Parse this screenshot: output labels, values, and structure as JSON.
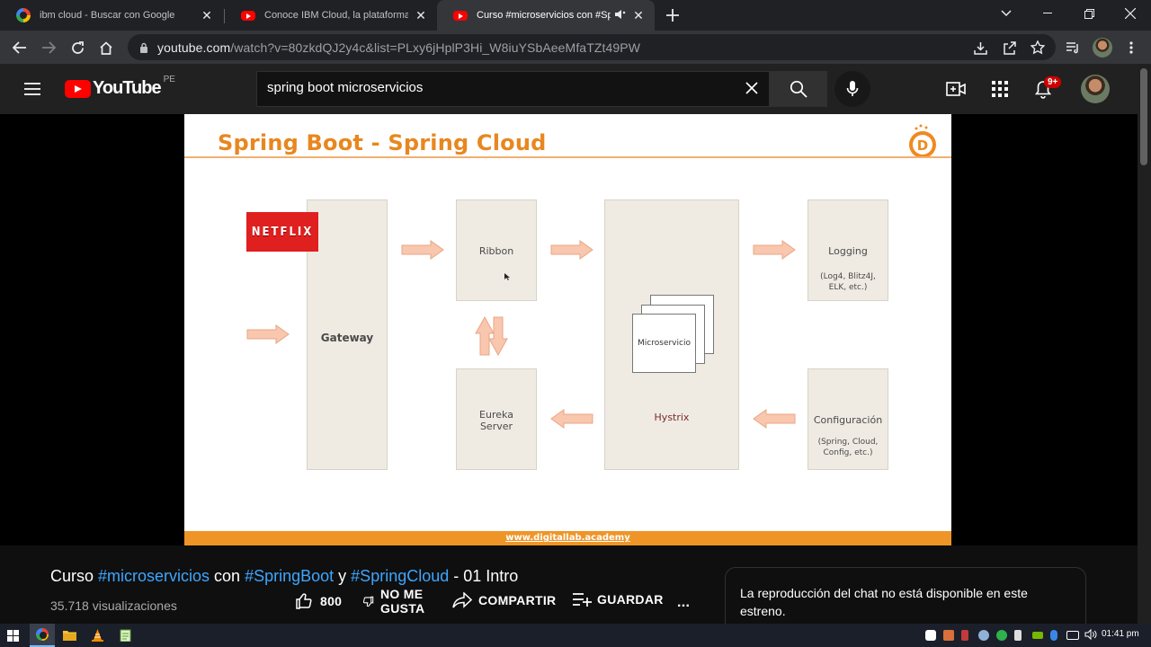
{
  "browser": {
    "tabs": [
      {
        "title": "ibm cloud - Buscar con Google",
        "favicon": "google-g-icon",
        "active": false
      },
      {
        "title": "Conoce IBM Cloud, la plataforma de nu",
        "favicon": "youtube-icon",
        "active": false
      },
      {
        "title": "Curso #microservicios con #Spring",
        "favicon": "youtube-icon",
        "active": true,
        "audio": "speaker-icon"
      }
    ],
    "url_host": "youtube.com",
    "url_path": "/watch?v=80zkdQJ2y4c&list=PLxy6jHplP3Hi_W8iuYSbAeeMfaTZt49PW"
  },
  "youtube": {
    "logo_text": "YouTube",
    "country_code": "PE",
    "search_value": "spring boot microservicios",
    "notification_count": "9+"
  },
  "slide": {
    "title": "Spring Boot - Spring Cloud",
    "footer": "www.digitallab.academy",
    "netflix": "NETFLIX",
    "gateway": "Gateway",
    "ribbon": "Ribbon",
    "eureka_line1": "Eureka",
    "eureka_line2": "Server",
    "microservicio": "Microservicio",
    "hystrix": "Hystrix",
    "logging": "Logging",
    "logging_sub1": "(Log4, Blitz4J,",
    "logging_sub2": "ELK, etc.)",
    "config": "Configuración",
    "config_sub1": "(Spring, Cloud,",
    "config_sub2": "Config, etc.)",
    "logo_letter": "D"
  },
  "video": {
    "title_parts": [
      "Curso ",
      "#microservicios",
      " con ",
      "#SpringBoot",
      " y ",
      "#SpringCloud",
      " - 01 Intro"
    ],
    "views": "35.718 visualizaciones",
    "likes": "800",
    "dislike_line1": "NO ME",
    "dislike_line2": "GUSTA",
    "share": "COMPARTIR",
    "save": "GUARDAR",
    "more": "..."
  },
  "chat": {
    "message": "La reproducción del chat no está disponible en este estreno."
  },
  "taskbar": {
    "time": "01:41 pm"
  }
}
